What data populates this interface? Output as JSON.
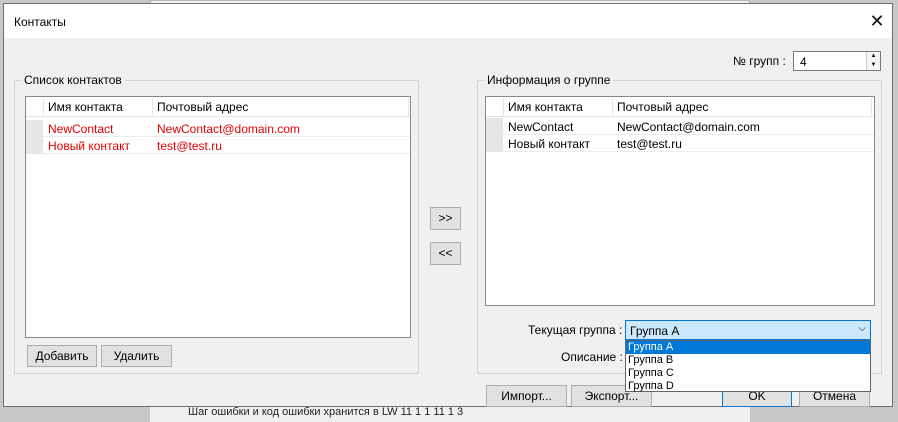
{
  "background": {
    "footer_text": "Шаг ошибки и код ошибки хранится в LW 11 1 1 11 1 3"
  },
  "dialog": {
    "title": "Контакты",
    "close_label": "✕"
  },
  "group_count": {
    "label": "№ групп :",
    "value": "4",
    "up": "▲",
    "down": "▼"
  },
  "contact_list": {
    "title": "Список контактов",
    "columns": [
      "Имя контакта",
      "Почтовый адрес"
    ],
    "rows": [
      {
        "name": "NewContact",
        "email": "NewContact@domain.com"
      },
      {
        "name": "Новый контакт",
        "email": "test@test.ru"
      }
    ],
    "add_label": "Добавить",
    "delete_label": "Удалить"
  },
  "transfer": {
    "add_label": ">>",
    "remove_label": "<<"
  },
  "group_info": {
    "title": "Информация о группе",
    "columns": [
      "Имя контакта",
      "Почтовый адрес"
    ],
    "rows": [
      {
        "name": "NewContact",
        "email": "NewContact@domain.com"
      },
      {
        "name": "Новый контакт",
        "email": "test@test.ru"
      }
    ],
    "current_group_label": "Текущая группа :",
    "current_group_value": "Группа A",
    "description_label": "Описание :",
    "options": [
      "Группа A",
      "Группа B",
      "Группа C",
      "Группа D"
    ]
  },
  "footer": {
    "import_label": "Импорт...",
    "export_label": "Экспорт...",
    "ok_label": "OK",
    "cancel_label": "Отмена"
  }
}
